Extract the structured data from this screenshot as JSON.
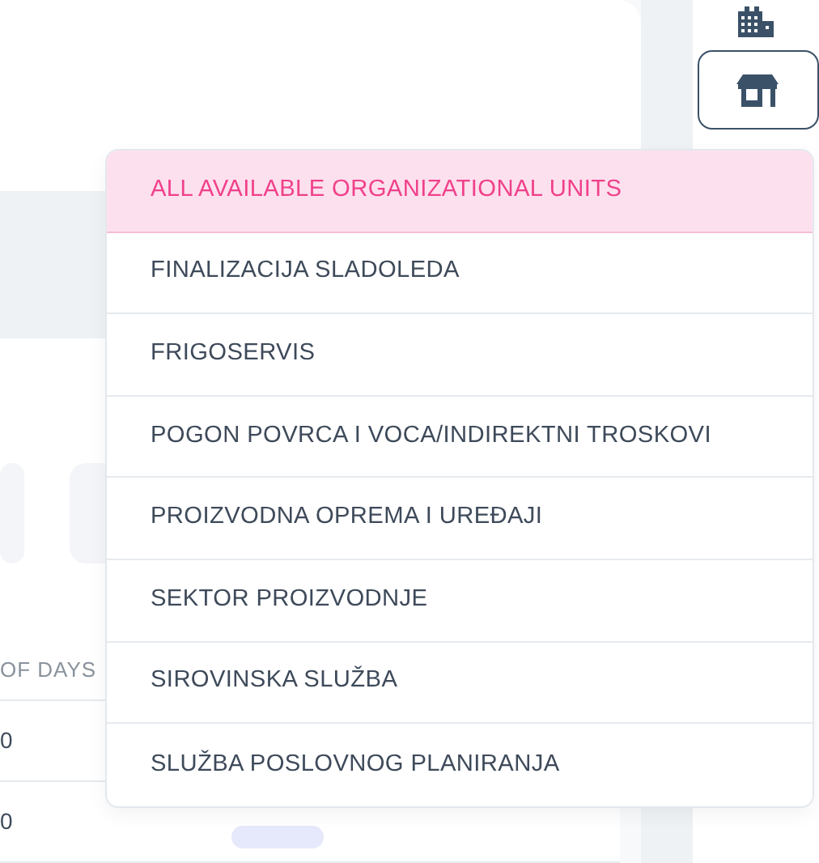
{
  "table": {
    "columns": [
      "OF DAYS"
    ],
    "rows": [
      [
        "0"
      ],
      [
        "0"
      ]
    ]
  },
  "dropdown": {
    "items": [
      {
        "label": "ALL AVAILABLE ORGANIZATIONAL UNITS",
        "selected": true
      },
      {
        "label": "FINALIZACIJA SLADOLEDA",
        "selected": false
      },
      {
        "label": "FRIGOSERVIS",
        "selected": false
      },
      {
        "label": "POGON POVRCA I VOCA/INDIREKTNI TROSKOVI",
        "selected": false
      },
      {
        "label": "PROIZVODNA OPREMA I UREĐAJI",
        "selected": false
      },
      {
        "label": "SEKTOR PROIZVODNJE",
        "selected": false
      },
      {
        "label": "SIROVINSKA SLUŽBA",
        "selected": false
      },
      {
        "label": "SLUŽBA POSLOVNOG PLANIRANJA",
        "selected": false
      }
    ]
  }
}
